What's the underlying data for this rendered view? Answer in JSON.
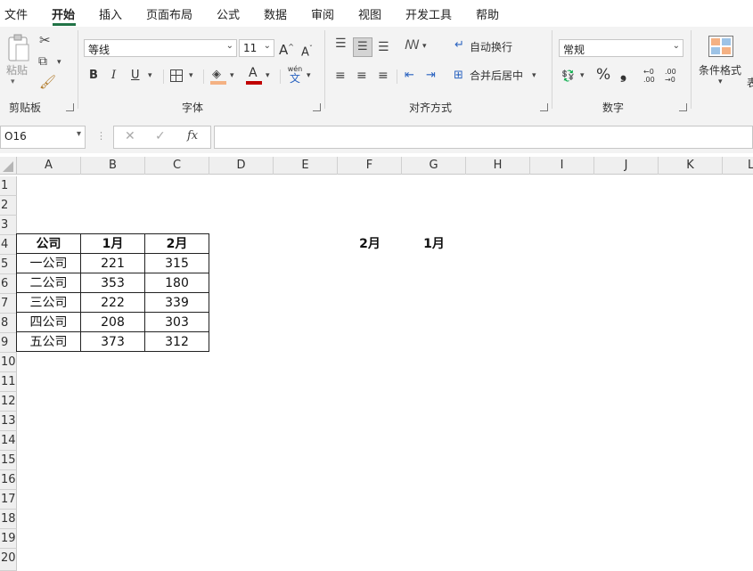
{
  "menu": {
    "items": [
      "文件",
      "开始",
      "插入",
      "页面布局",
      "公式",
      "数据",
      "审阅",
      "视图",
      "开发工具",
      "帮助"
    ],
    "active": "开始"
  },
  "ribbon": {
    "clipboard": {
      "paste_label": "粘贴",
      "group_label": "剪贴板"
    },
    "font": {
      "font_name": "等线",
      "font_size": "11",
      "group_label": "字体",
      "bold": "B",
      "italic": "I",
      "underline": "U",
      "phonetic_top": "wén",
      "phonetic_bottom": "文"
    },
    "alignment": {
      "wrap_label": "自动换行",
      "merge_label": "合并后居中",
      "group_label": "对齐方式"
    },
    "number": {
      "format": "常规",
      "group_label": "数字",
      "percent": "%",
      "comma": "❟"
    },
    "styles": {
      "cond_format_label": "条件格式"
    },
    "table_partial": "表"
  },
  "formula_bar": {
    "name_box": "O16",
    "fx": "fx",
    "cancel": "✕",
    "confirm": "✓",
    "formula": ""
  },
  "columns": [
    "A",
    "B",
    "C",
    "D",
    "E",
    "F",
    "G",
    "H",
    "I",
    "J",
    "K",
    "L"
  ],
  "rows": [
    "1",
    "2",
    "3",
    "4",
    "5",
    "6",
    "7",
    "8",
    "9",
    "10",
    "11",
    "12",
    "13",
    "14",
    "15",
    "16",
    "17",
    "18",
    "19",
    "20"
  ],
  "table": {
    "headers": [
      "公司",
      "1月",
      "2月"
    ],
    "rows": [
      [
        "一公司",
        "221",
        "315"
      ],
      [
        "二公司",
        "353",
        "180"
      ],
      [
        "三公司",
        "222",
        "339"
      ],
      [
        "四公司",
        "208",
        "303"
      ],
      [
        "五公司",
        "373",
        "312"
      ]
    ]
  },
  "extra_labels": {
    "f4": "2月",
    "g4": "1月"
  },
  "colors": {
    "accent": "#217346",
    "fill_color": "#f4b183",
    "font_color": "#c00000"
  }
}
